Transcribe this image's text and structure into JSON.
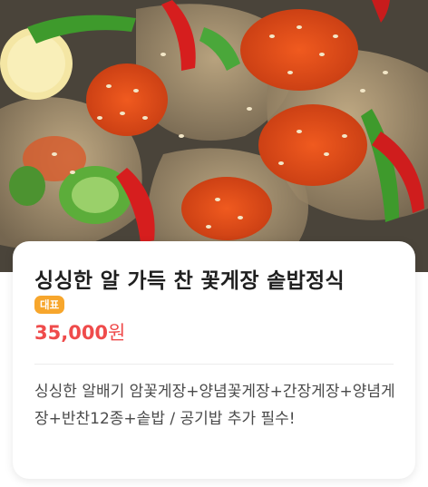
{
  "photo": {
    "alt": ""
  },
  "menu": {
    "title": "싱싱한 알 가득 찬 꽃게장 솥밥정식",
    "badge": "대표",
    "price": "35,000",
    "price_unit": "원",
    "description": "싱싱한 알배기 암꽃게장+양념꽃게장+간장게장+양념게장+반찬12종+솥밥 / 공기밥 추가 필수!"
  },
  "colors": {
    "badge": "#f7a62c",
    "price": "#ef4b4b",
    "title": "#1f1f1f"
  }
}
